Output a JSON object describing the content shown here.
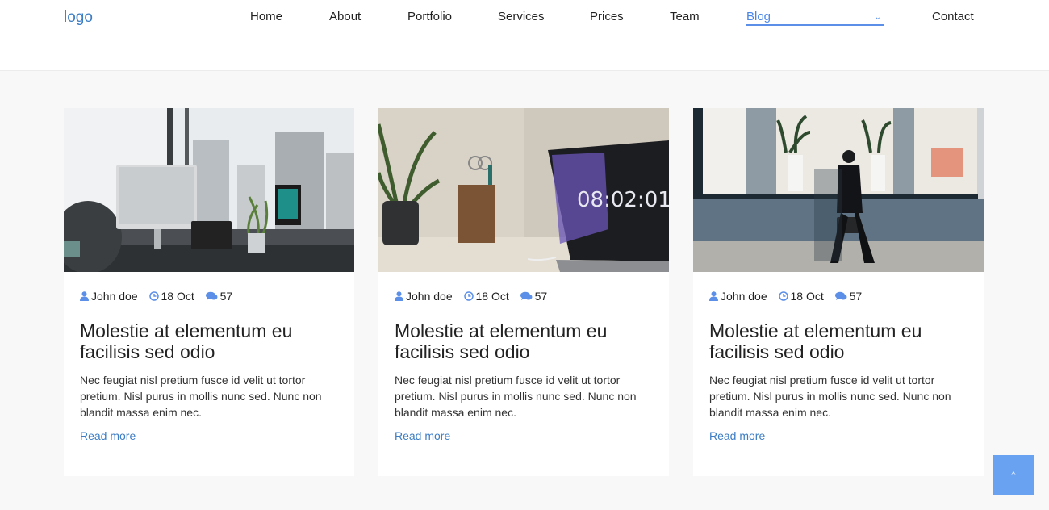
{
  "header": {
    "logo": "logo",
    "nav": [
      "Home",
      "About",
      "Portfolio",
      "Services",
      "Prices",
      "Team",
      "Blog",
      "Contact"
    ],
    "active": "Blog"
  },
  "accent_color": "#4a86e8",
  "icons": {
    "author": "user-icon",
    "date": "clock-icon",
    "comments": "comments-icon",
    "dropdown": "chevron-down-icon",
    "scroll_top": "chevron-up-icon"
  },
  "posts": [
    {
      "image": "office-desk-photo",
      "author": "John doe",
      "date": "18 Oct",
      "comments": "57",
      "title": "Molestie at elementum eu facilisis sed odio",
      "excerpt": "Nec feugiat nisl pretium fusce id velit ut tortor pretium. Nisl purus in mollis nunc sed. Nunc non blandit massa enim nec.",
      "link": "Read more"
    },
    {
      "image": "laptop-plant-photo",
      "author": "John doe",
      "date": "18 Oct",
      "comments": "57",
      "title": "Molestie at elementum eu facilisis sed odio",
      "excerpt": "Nec feugiat nisl pretium fusce id velit ut tortor pretium. Nisl purus in mollis nunc sed. Nunc non blandit massa enim nec.",
      "link": "Read more"
    },
    {
      "image": "street-walker-photo",
      "author": "John doe",
      "date": "18 Oct",
      "comments": "57",
      "title": "Molestie at elementum eu facilisis sed odio",
      "excerpt": "Nec feugiat nisl pretium fusce id velit ut tortor pretium. Nisl purus in mollis nunc sed. Nunc non blandit massa enim nec.",
      "link": "Read more"
    }
  ],
  "scroll_top": "^"
}
